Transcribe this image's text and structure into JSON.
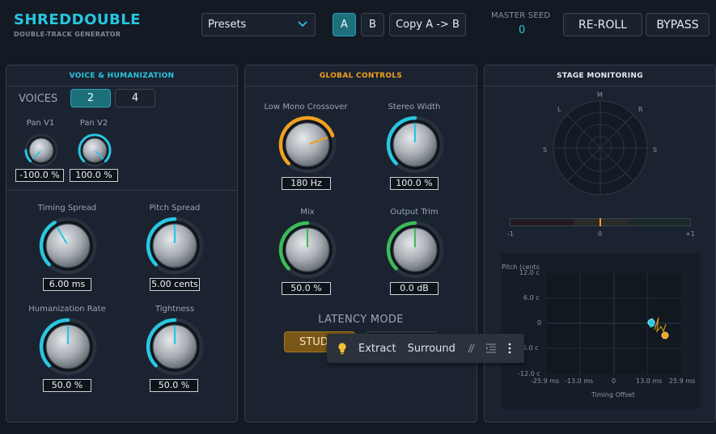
{
  "header": {
    "title": "SHREDDOUBLE",
    "subtitle": "DOUBLE-TRACK GENERATOR",
    "presets_label": "Presets",
    "ab": {
      "a": "A",
      "b": "B",
      "copy": "Copy A -> B"
    },
    "master_seed_label": "MASTER SEED",
    "master_seed_value": "0",
    "reroll": "RE-ROLL",
    "bypass": "BYPASS"
  },
  "voice": {
    "title": "VOICE & HUMANIZATION",
    "voices_label": "VOICES",
    "voices_options": [
      "2",
      "4"
    ],
    "voices_selected": "2",
    "pan_v1": {
      "label": "Pan V1",
      "value": "-100.0 %"
    },
    "pan_v2": {
      "label": "Pan V2",
      "value": "100.0 %"
    },
    "timing_spread": {
      "label": "Timing Spread",
      "value": "6.00 ms"
    },
    "pitch_spread": {
      "label": "Pitch Spread",
      "value": "5.00 cents"
    },
    "humanization_rate": {
      "label": "Humanization Rate",
      "value": "50.0 %"
    },
    "tightness": {
      "label": "Tightness",
      "value": "50.0 %"
    }
  },
  "global": {
    "title": "GLOBAL CONTROLS",
    "crossover": {
      "label": "Low Mono Crossover",
      "value": "180 Hz"
    },
    "stereo_width": {
      "label": "Stereo Width",
      "value": "100.0 %"
    },
    "mix": {
      "label": "Mix",
      "value": "50.0 %"
    },
    "output_trim": {
      "label": "Output Trim",
      "value": "0.0 dB"
    },
    "latency_label": "LATENCY MODE",
    "latency_selected": "STUDIO"
  },
  "stage": {
    "title": "STAGE MONITORING",
    "polar_labels": {
      "m": "M",
      "l": "L",
      "r": "R",
      "sl": "S",
      "sr": "S"
    },
    "correlation": {
      "min": "-1",
      "mid": "0",
      "max": "+1",
      "value": 0.0
    },
    "scatter": {
      "y_title": "Pitch (cents",
      "y_ticks": [
        "12.0 c",
        "6.0 c",
        "0",
        "-6.0 c",
        "-12.0 c"
      ],
      "x_ticks": [
        "-25.9 ms",
        "-13.0 ms",
        "0",
        "13.0 ms",
        "25.9 ms"
      ],
      "x_title": "Timing Offset"
    }
  },
  "toolbar": {
    "extract": "Extract",
    "surround": "Surround"
  },
  "colors": {
    "accent": "#29c6e0",
    "orange": "#f0a020",
    "green": "#3dbb5a"
  }
}
